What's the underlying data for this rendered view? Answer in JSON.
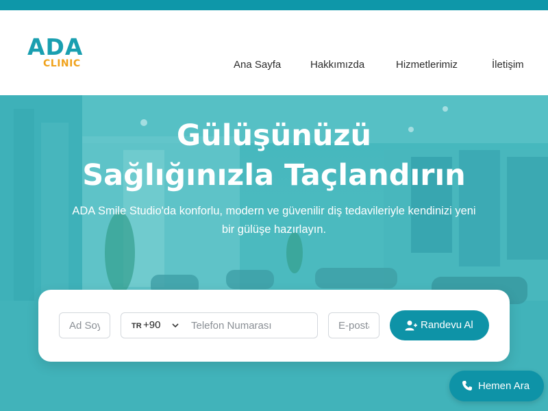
{
  "brand": {
    "logo_main": "ADA",
    "logo_sub": "CLINIC",
    "primary_color": "#0e93a7",
    "logo_accent_color": "#f0a21b"
  },
  "nav": {
    "items": [
      {
        "label": "Ana Sayfa"
      },
      {
        "label": "Hakkımızda"
      },
      {
        "label": "Hizmetlerimiz"
      },
      {
        "label": "İletişim"
      }
    ]
  },
  "hero": {
    "title_line1": "Gülüşünüzü",
    "title_line2": "Sağlığınızla Taçlandırın",
    "desc_line1": "ADA Smile Studio'da konforlu, modern ve güvenilir diş tedavileriyle kendinizi yeni",
    "desc_line2": "bir gülüşe hazırlayın."
  },
  "form": {
    "name_placeholder": "Ad Soyad",
    "country_flag": "TR",
    "country_code": "+90",
    "phone_placeholder": "Telefon Numarası",
    "email_placeholder": "E-posta",
    "submit_label": "Randevu Al",
    "submit_icon": "user-plus-icon"
  },
  "floating": {
    "call_label": "Hemen Ara",
    "call_icon": "phone-icon"
  }
}
